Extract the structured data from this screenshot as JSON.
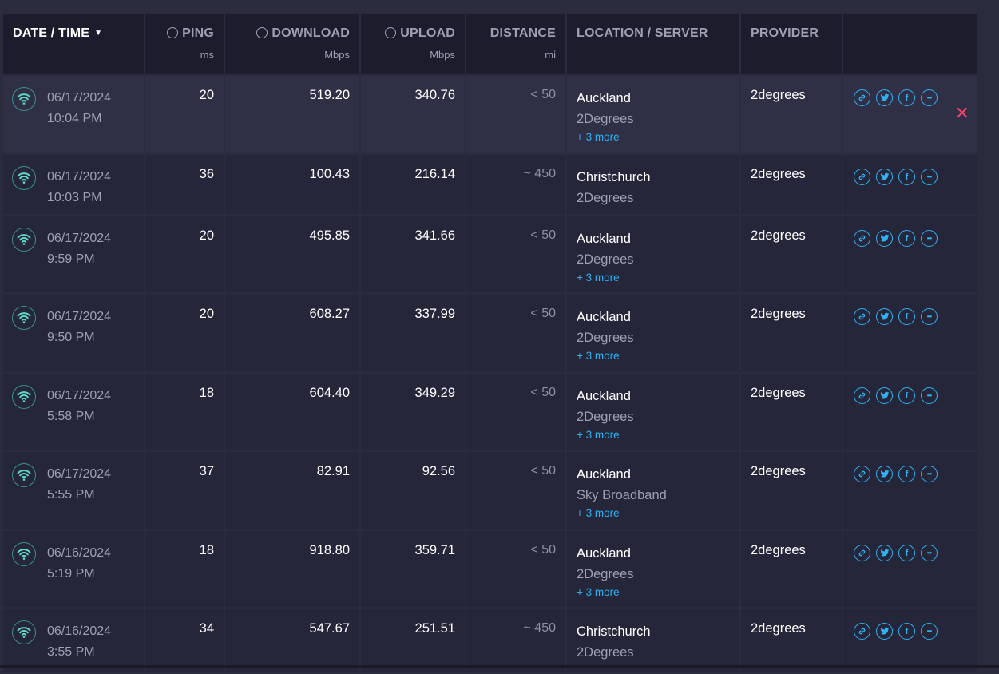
{
  "header": {
    "date": "DATE / TIME",
    "ping": "PING",
    "ping_unit": "ms",
    "download": "DOWNLOAD",
    "download_unit": "Mbps",
    "upload": "UPLOAD",
    "upload_unit": "Mbps",
    "distance": "DISTANCE",
    "distance_unit": "mi",
    "location": "LOCATION / SERVER",
    "provider": "PROVIDER"
  },
  "rows": [
    {
      "date": "06/17/2024",
      "time": "10:04 PM",
      "ping": "20",
      "download": "519.20",
      "upload": "340.76",
      "distance": "< 50",
      "city": "Auckland",
      "server": "2Degrees",
      "more": "+ 3 more",
      "provider": "2degrees"
    },
    {
      "date": "06/17/2024",
      "time": "10:03 PM",
      "ping": "36",
      "download": "100.43",
      "upload": "216.14",
      "distance": "~ 450",
      "city": "Christchurch",
      "server": "2Degrees",
      "more": "",
      "provider": "2degrees"
    },
    {
      "date": "06/17/2024",
      "time": "9:59 PM",
      "ping": "20",
      "download": "495.85",
      "upload": "341.66",
      "distance": "< 50",
      "city": "Auckland",
      "server": "2Degrees",
      "more": "+ 3 more",
      "provider": "2degrees"
    },
    {
      "date": "06/17/2024",
      "time": "9:50 PM",
      "ping": "20",
      "download": "608.27",
      "upload": "337.99",
      "distance": "< 50",
      "city": "Auckland",
      "server": "2Degrees",
      "more": "+ 3 more",
      "provider": "2degrees"
    },
    {
      "date": "06/17/2024",
      "time": "5:58 PM",
      "ping": "18",
      "download": "604.40",
      "upload": "349.29",
      "distance": "< 50",
      "city": "Auckland",
      "server": "2Degrees",
      "more": "+ 3 more",
      "provider": "2degrees"
    },
    {
      "date": "06/17/2024",
      "time": "5:55 PM",
      "ping": "37",
      "download": "82.91",
      "upload": "92.56",
      "distance": "< 50",
      "city": "Auckland",
      "server": "Sky Broadband",
      "more": "+ 3 more",
      "provider": "2degrees"
    },
    {
      "date": "06/16/2024",
      "time": "5:19 PM",
      "ping": "18",
      "download": "918.80",
      "upload": "359.71",
      "distance": "< 50",
      "city": "Auckland",
      "server": "2Degrees",
      "more": "+ 3 more",
      "provider": "2degrees"
    },
    {
      "date": "06/16/2024",
      "time": "3:55 PM",
      "ping": "34",
      "download": "547.67",
      "upload": "251.51",
      "distance": "~ 450",
      "city": "Christchurch",
      "server": "2Degrees",
      "more": "",
      "provider": "2degrees"
    }
  ],
  "actions": {
    "link_icon": "link-icon",
    "twitter_icon": "twitter-icon",
    "facebook_icon": "facebook-icon",
    "more_icon": "more-icon",
    "delete_icon": "close-icon",
    "facebook_glyph": "f",
    "more_glyph": "•••",
    "close_glyph": "✕"
  },
  "colors": {
    "accent": "#2fb1f2",
    "delete": "#e8476b",
    "wifi": "#5fd6c8"
  }
}
